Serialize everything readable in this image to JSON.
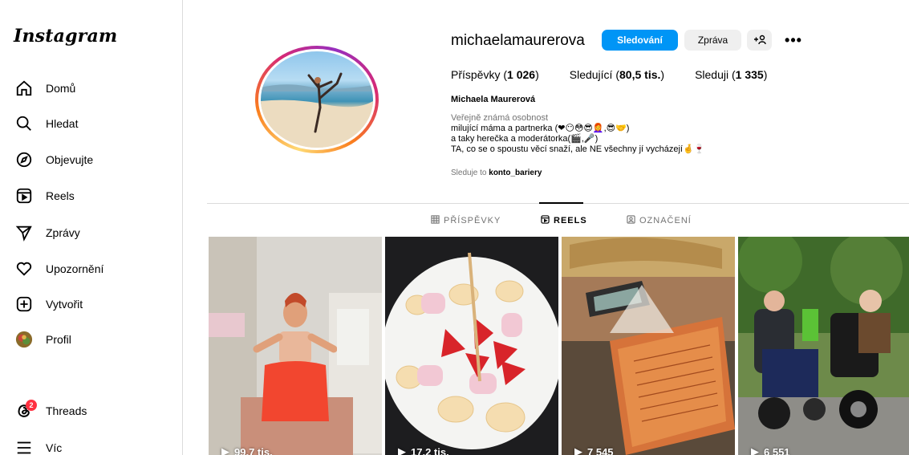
{
  "app": {
    "logo": "Instagram"
  },
  "sidebar": {
    "items": [
      {
        "label": "Domů",
        "icon": "home-icon"
      },
      {
        "label": "Hledat",
        "icon": "search-icon"
      },
      {
        "label": "Objevujte",
        "icon": "compass-icon"
      },
      {
        "label": "Reels",
        "icon": "reels-icon"
      },
      {
        "label": "Zprávy",
        "icon": "send-icon"
      },
      {
        "label": "Upozornění",
        "icon": "heart-icon"
      },
      {
        "label": "Vytvořit",
        "icon": "plus-square-icon"
      },
      {
        "label": "Profil",
        "icon": "profile-avatar-icon"
      }
    ],
    "threads": {
      "label": "Threads",
      "badge": "2",
      "icon": "threads-icon"
    },
    "more": {
      "label": "Víc",
      "icon": "hamburger-menu-icon"
    }
  },
  "profile": {
    "username": "michaelamaurerova",
    "follow_label": "Sledování",
    "message_label": "Zpráva",
    "add_label": "+𐀀",
    "more_label": "•••",
    "stats": {
      "posts_label": "Příspěvky",
      "posts_count": "1 026",
      "followers_label": "Sledující",
      "followers_count": "80,5 tis.",
      "following_label": "Sleduji",
      "following_count": "1 335"
    },
    "full_name": "Michaela Maurerová",
    "category": "Veřejně známá osobnost",
    "bio_lines": [
      "milující máma a partnerka (❤😶😳😎👩‍🦰,😎🤝)",
      "a taky herečka a moderátorka(🎬,🎤)",
      "TA, co se o spoustu věcí snaží, ale NE všechny jí vycházejí🤞🍷"
    ],
    "followed_by_prefix": "Sleduje to",
    "followed_by_user": "konto_bariery"
  },
  "tabs": [
    {
      "label": "PŘÍSPĚVKY",
      "icon": "grid-icon",
      "active": false
    },
    {
      "label": "REELS",
      "icon": "reels-icon",
      "active": true
    },
    {
      "label": "OZNAČENÍ",
      "icon": "tagged-icon",
      "active": false
    }
  ],
  "reels": [
    {
      "views": "99,7 tis."
    },
    {
      "views": "17,2 tis."
    },
    {
      "views": "7 545"
    },
    {
      "views": "6 551"
    }
  ],
  "colors": {
    "accent": "#0095f6",
    "badge": "#ff3040",
    "border": "#dbdbdb",
    "muted": "#737373"
  }
}
